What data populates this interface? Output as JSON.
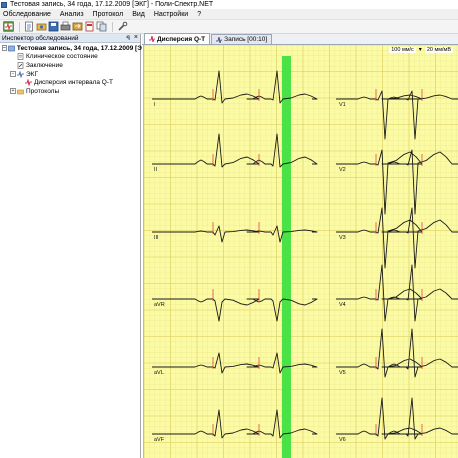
{
  "window": {
    "title": "Тестовая запись, 34 года, 17.12.2009 [ЭКГ] - Поли-Спектр.NET"
  },
  "menu": [
    "Обследование",
    "Анализ",
    "Протокол",
    "Вид",
    "Настройки",
    "?"
  ],
  "toolbar": {
    "buttons": [
      "new-exam-icon",
      "open-icon",
      "record-icon",
      "save-icon",
      "print-icon",
      "export-icon",
      "report-icon",
      "copy-icon",
      "settings-wrench-icon"
    ]
  },
  "inspector": {
    "title": "Инспектор обследований",
    "pin": "ꟼ",
    "close": "×",
    "tree": [
      {
        "label": "Тестовая запись, 34 года, 17.12.2009 [ЭКГ]",
        "level": 0,
        "bold": true,
        "exp": "−",
        "icon": "patient-record-icon"
      },
      {
        "label": "Клиническое состояние",
        "level": 1,
        "bold": false,
        "exp": "",
        "icon": "clinical-state-icon"
      },
      {
        "label": "Заключение",
        "level": 1,
        "bold": false,
        "exp": "",
        "icon": "conclusion-icon"
      },
      {
        "label": "ЭКГ",
        "level": 1,
        "bold": false,
        "exp": "−",
        "icon": "ecg-icon"
      },
      {
        "label": "Дисперсия интервала Q-T",
        "level": 2,
        "bold": false,
        "exp": "",
        "icon": "qt-dispersion-icon"
      },
      {
        "label": "Протоколы",
        "level": 1,
        "bold": false,
        "exp": "+",
        "icon": "folder-icon"
      }
    ]
  },
  "tabs": [
    {
      "label": "Дисперсия Q-T",
      "active": true,
      "icon": "qt-dispersion-icon"
    },
    {
      "label": "Запись [00:10]",
      "active": false,
      "icon": "ecg-record-icon"
    }
  ],
  "controls": {
    "speed": "100 мм/с",
    "amplitude": "20 мм/мВ"
  },
  "colors": {
    "grid_bg": "#fbfba6",
    "grid_minor": "#efe98a",
    "grid_major": "#dccf63",
    "trace": "#1a1a1a",
    "marker": "#40e040",
    "qt_mark": "#e03030"
  },
  "ecg": {
    "leads_left": [
      "I",
      "II",
      "III",
      "aVR",
      "aVL",
      "aVF"
    ],
    "leads_right": [
      "V1",
      "V2",
      "V3",
      "V4",
      "V5",
      "V6"
    ]
  }
}
